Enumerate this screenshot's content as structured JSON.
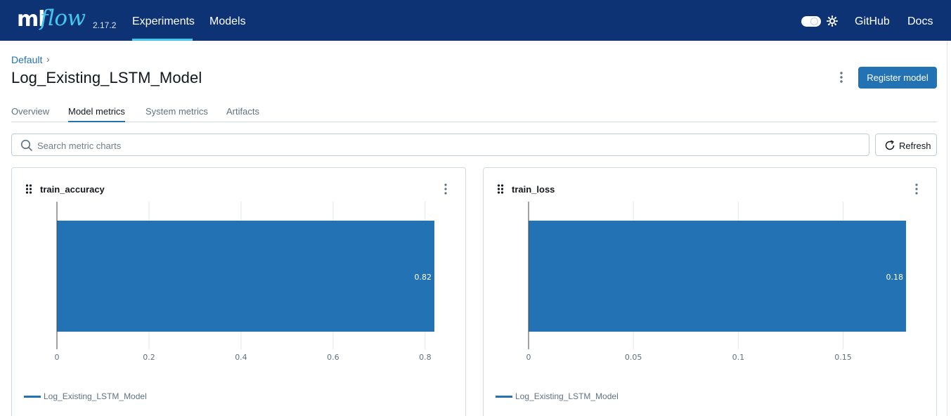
{
  "app": {
    "logo_ml": "ml",
    "logo_flow": "flow",
    "version": "2.17.2",
    "nav": [
      {
        "label": "Experiments"
      },
      {
        "label": "Models"
      }
    ],
    "links": {
      "github": "GitHub",
      "docs": "Docs"
    }
  },
  "header": {
    "breadcrumb": "Default",
    "breadcrumb_sep": "›",
    "title": "Log_Existing_LSTM_Model",
    "register_label": "Register model"
  },
  "tabs": [
    {
      "label": "Overview"
    },
    {
      "label": "Model metrics"
    },
    {
      "label": "System metrics"
    },
    {
      "label": "Artifacts"
    }
  ],
  "search": {
    "placeholder": "Search metric charts",
    "value": ""
  },
  "refresh_label": "Refresh",
  "colors": {
    "nav_bg": "#0e3374",
    "accent": "#43c9ed",
    "primary": "#2272b4",
    "bar": "#2272b4"
  },
  "cards": [
    {
      "title": "train_accuracy",
      "legend": "Log_Existing_LSTM_Model"
    },
    {
      "title": "train_loss",
      "legend": "Log_Existing_LSTM_Model"
    }
  ],
  "chart_data": [
    {
      "type": "bar",
      "orientation": "horizontal",
      "title": "train_accuracy",
      "categories": [
        "Log_Existing_LSTM_Model"
      ],
      "series": [
        {
          "name": "Log_Existing_LSTM_Model",
          "values": [
            0.82
          ]
        }
      ],
      "value_labels": [
        "0.82"
      ],
      "xticks": [
        0,
        0.2,
        0.4,
        0.6,
        0.8
      ],
      "xtick_labels": [
        "0",
        "0.2",
        "0.4",
        "0.6",
        "0.8"
      ],
      "xlim": [
        0,
        0.82
      ],
      "grid": true,
      "legend_position": "bottom-left"
    },
    {
      "type": "bar",
      "orientation": "horizontal",
      "title": "train_loss",
      "categories": [
        "Log_Existing_LSTM_Model"
      ],
      "series": [
        {
          "name": "Log_Existing_LSTM_Model",
          "values": [
            0.18
          ]
        }
      ],
      "value_labels": [
        "0.18"
      ],
      "xticks": [
        0,
        0.05,
        0.1,
        0.15
      ],
      "xtick_labels": [
        "0",
        "0.05",
        "0.1",
        "0.15"
      ],
      "xlim": [
        0,
        0.18
      ],
      "grid": true,
      "legend_position": "bottom-left"
    }
  ]
}
